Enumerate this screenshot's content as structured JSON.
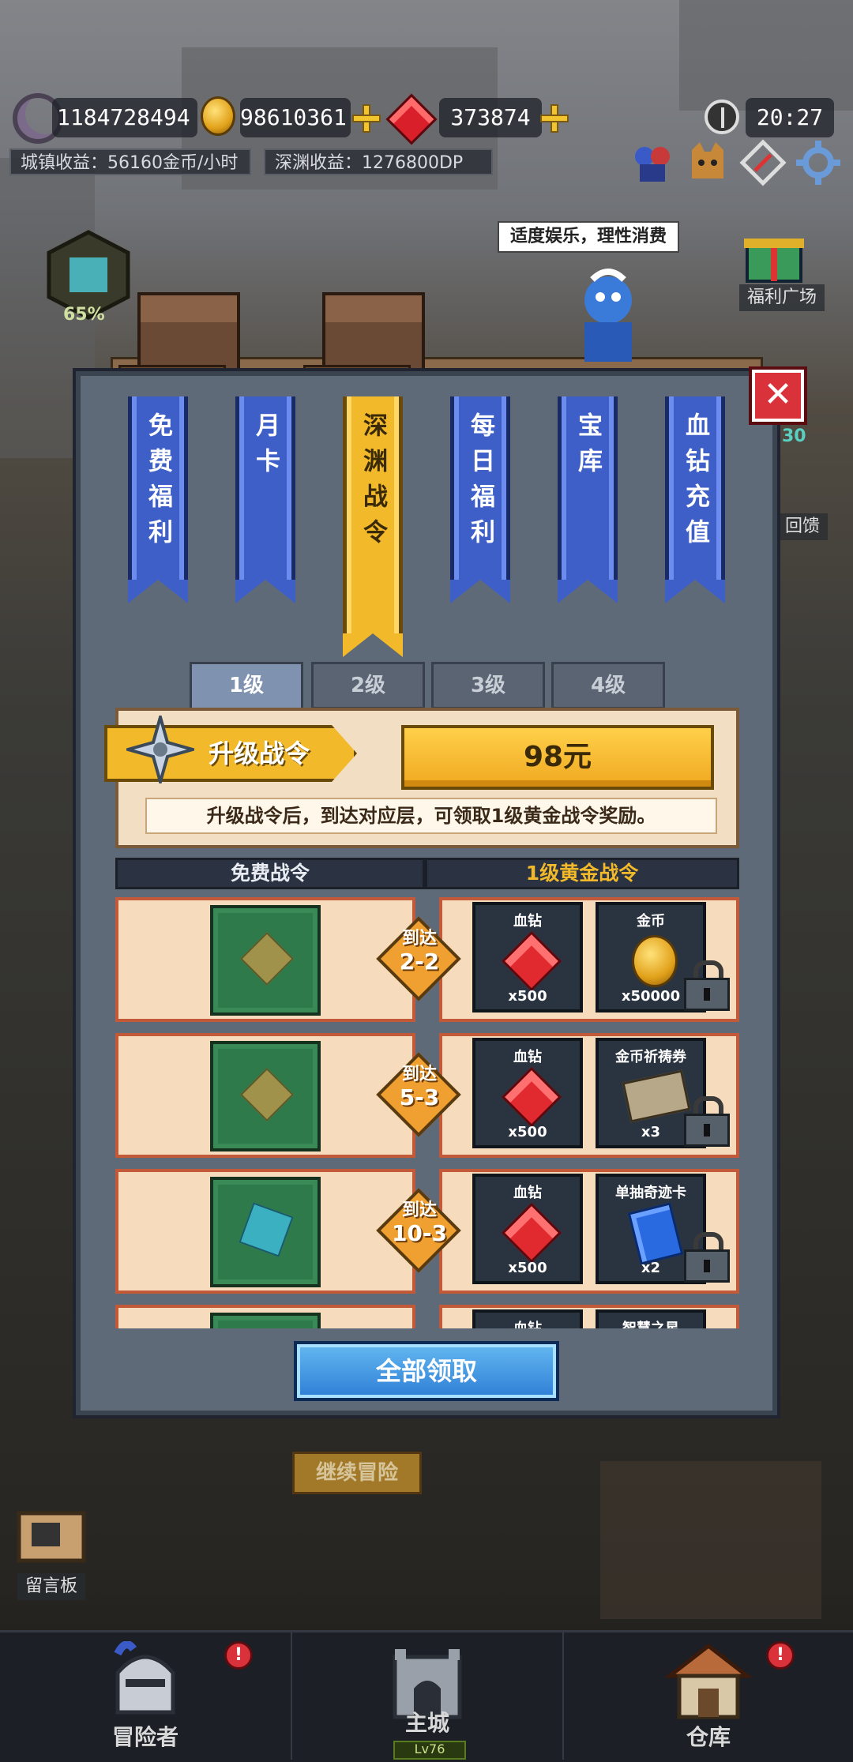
{
  "hud": {
    "stat1": "1184728494",
    "gold": "98610361",
    "gems": "373874",
    "time": "20:27",
    "town_income": "城镇收益：56160金币/小时",
    "abyss_income": "深渊收益：1276800DP",
    "progress_pct": "65%"
  },
  "side": {
    "welfare_plaza": "福利广场",
    "tip": "适度娱乐，理性消费",
    "partial_label_1": "回馈",
    "partial_count": "30",
    "message_board": "留言板"
  },
  "ribbons": [
    {
      "label": "免费福利"
    },
    {
      "label": "月卡"
    },
    {
      "label": "深渊战令"
    },
    {
      "label": "每日福利"
    },
    {
      "label": "宝库"
    },
    {
      "label": "血钻充值"
    }
  ],
  "level_tabs": [
    "1级",
    "2级",
    "3级",
    "4级"
  ],
  "upgrade": {
    "label": "升级战令",
    "price": "98元",
    "note": "升级战令后，到达对应层，可领取1级黄金战令奖励。"
  },
  "columns": {
    "free": "免费战令",
    "gold": "1级黄金战令"
  },
  "rows": [
    {
      "reach": "到达",
      "floor": "2-2",
      "rewards": [
        {
          "name": "血钻",
          "count": "x500",
          "icon": "red-gem"
        },
        {
          "name": "金币",
          "count": "x50000",
          "icon": "gold-coin"
        }
      ]
    },
    {
      "reach": "到达",
      "floor": "5-3",
      "rewards": [
        {
          "name": "血钻",
          "count": "x500",
          "icon": "red-gem"
        },
        {
          "name": "金币祈祷券",
          "count": "x3",
          "icon": "scroll"
        }
      ]
    },
    {
      "reach": "到达",
      "floor": "10-3",
      "rewards": [
        {
          "name": "血钻",
          "count": "x500",
          "icon": "red-gem"
        },
        {
          "name": "单抽奇迹卡",
          "count": "x2",
          "icon": "blue-card"
        }
      ]
    },
    {
      "reach": "",
      "floor": "",
      "rewards": [
        {
          "name": "血钻",
          "count": "",
          "icon": "red-gem"
        },
        {
          "name": "智慧之星",
          "count": "",
          "icon": "star"
        }
      ]
    }
  ],
  "claim_all": "全部领取",
  "continue": "继续冒险",
  "nav": {
    "adventurer": "冒险者",
    "main_city": "主城",
    "main_city_level": "Lv76",
    "warehouse": "仓库",
    "badge": "!"
  }
}
